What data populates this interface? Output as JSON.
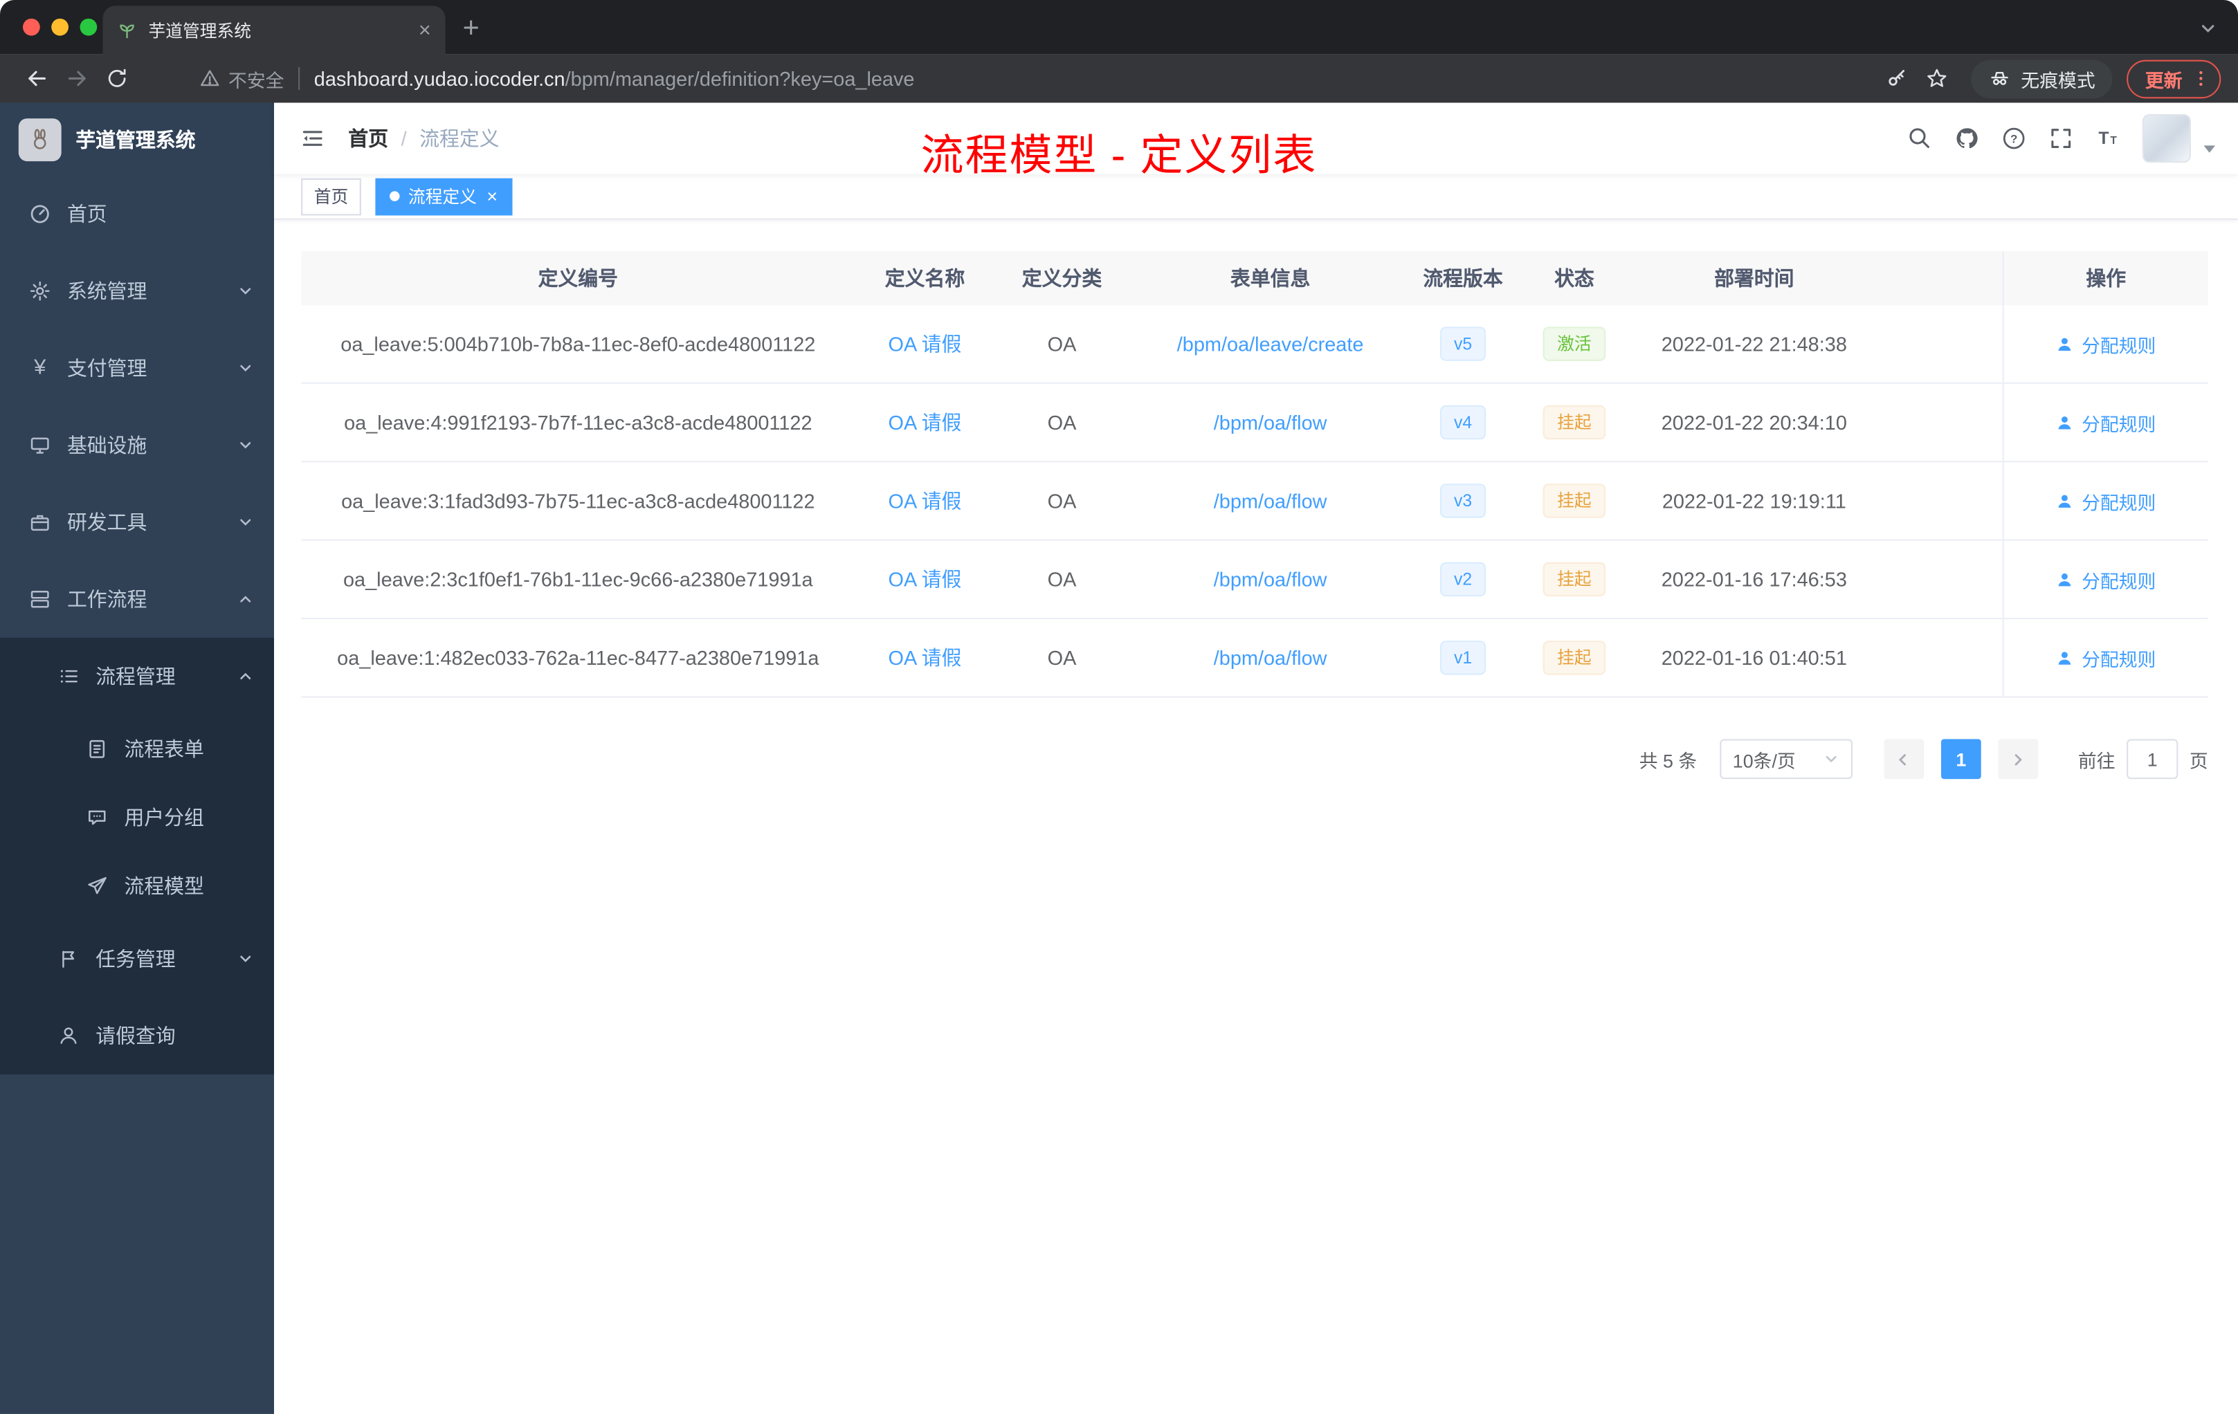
{
  "browser": {
    "tab_title": "芋道管理系统",
    "security_label": "不安全",
    "url_host": "dashboard.yudao.iocoder.cn",
    "url_path": "/bpm/manager/definition?key=oa_leave",
    "incognito_label": "无痕模式",
    "update_label": "更新"
  },
  "glyphs": {
    "close": "×",
    "new_tab": "+",
    "yen": "¥",
    "question": "?",
    "font_T_big": "T",
    "font_T_small": "T",
    "breadcrumb_separator": "/"
  },
  "sidebar": {
    "app_title": "芋道管理系统",
    "items": [
      {
        "label": "首页"
      },
      {
        "label": "系统管理"
      },
      {
        "label": "支付管理"
      },
      {
        "label": "基础设施"
      },
      {
        "label": "研发工具"
      },
      {
        "label": "工作流程"
      },
      {
        "label": "流程管理"
      },
      {
        "label": "流程表单"
      },
      {
        "label": "用户分组"
      },
      {
        "label": "流程模型"
      },
      {
        "label": "任务管理"
      },
      {
        "label": "请假查询"
      }
    ]
  },
  "header": {
    "breadcrumb_home": "首页",
    "breadcrumb_current": "流程定义",
    "annotation": "流程模型 - 定义列表"
  },
  "tags": {
    "home": "首页",
    "active": "流程定义"
  },
  "table": {
    "columns": [
      "定义编号",
      "定义名称",
      "定义分类",
      "表单信息",
      "流程版本",
      "状态",
      "部署时间",
      "操作"
    ],
    "rows": [
      {
        "id": "oa_leave:5:004b710b-7b8a-11ec-8ef0-acde48001122",
        "name": "OA 请假",
        "category": "OA",
        "form": "/bpm/oa/leave/create",
        "version": "v5",
        "status": "激活",
        "status_type": "success",
        "deploy_time": "2022-01-22 21:48:38",
        "action": "分配规则"
      },
      {
        "id": "oa_leave:4:991f2193-7b7f-11ec-a3c8-acde48001122",
        "name": "OA 请假",
        "category": "OA",
        "form": "/bpm/oa/flow",
        "version": "v4",
        "status": "挂起",
        "status_type": "warning",
        "deploy_time": "2022-01-22 20:34:10",
        "action": "分配规则"
      },
      {
        "id": "oa_leave:3:1fad3d93-7b75-11ec-a3c8-acde48001122",
        "name": "OA 请假",
        "category": "OA",
        "form": "/bpm/oa/flow",
        "version": "v3",
        "status": "挂起",
        "status_type": "warning",
        "deploy_time": "2022-01-22 19:19:11",
        "action": "分配规则"
      },
      {
        "id": "oa_leave:2:3c1f0ef1-76b1-11ec-9c66-a2380e71991a",
        "name": "OA 请假",
        "category": "OA",
        "form": "/bpm/oa/flow",
        "version": "v2",
        "status": "挂起",
        "status_type": "warning",
        "deploy_time": "2022-01-16 17:46:53",
        "action": "分配规则"
      },
      {
        "id": "oa_leave:1:482ec033-762a-11ec-8477-a2380e71991a",
        "name": "OA 请假",
        "category": "OA",
        "form": "/bpm/oa/flow",
        "version": "v1",
        "status": "挂起",
        "status_type": "warning",
        "deploy_time": "2022-01-16 01:40:51",
        "action": "分配规则"
      }
    ]
  },
  "pagination": {
    "total": "共 5 条",
    "page_size": "10条/页",
    "current": "1",
    "goto_label": "前往",
    "goto_value": "1",
    "unit_label": "页"
  },
  "colors": {
    "primary": "#409eff",
    "annotation_red": "#ff0000",
    "sidebar_bg": "#304156",
    "submenu_bg": "#1f2d3d",
    "status_active": "#67c23a",
    "status_suspended": "#e6a23c"
  }
}
